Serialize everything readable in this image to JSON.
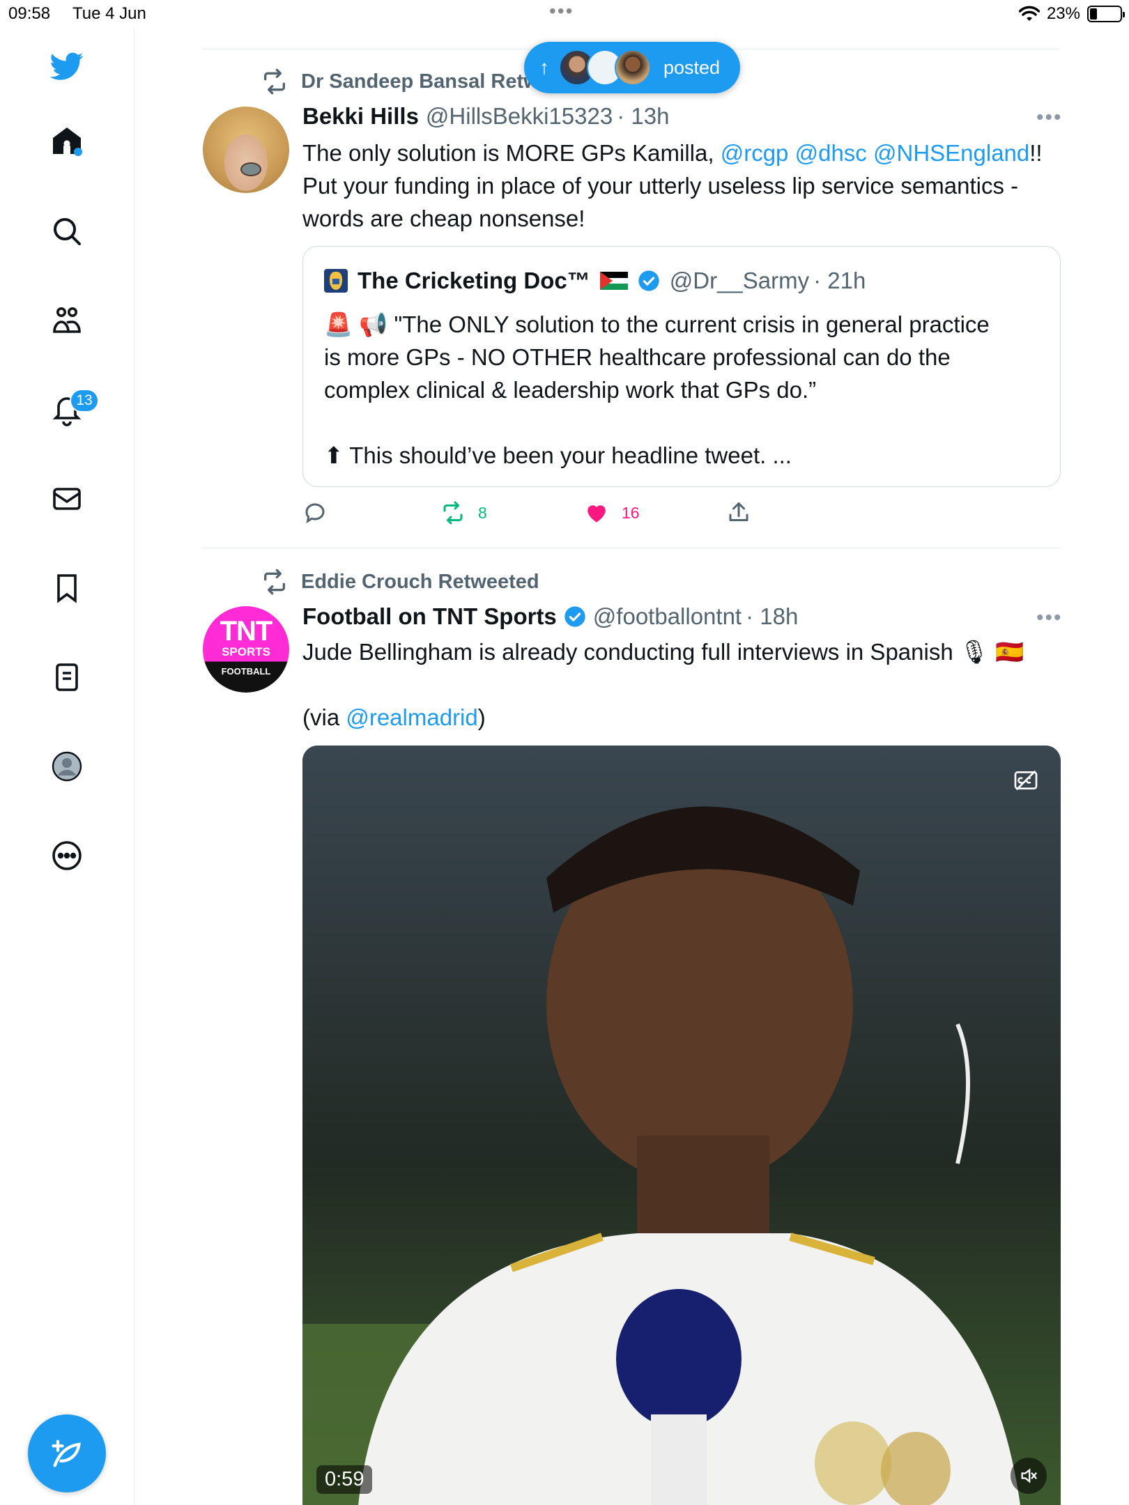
{
  "status_bar": {
    "time": "09:58",
    "date": "Tue 4 Jun",
    "dots": "•••",
    "battery": "23%",
    "battery_level": 0.23
  },
  "sidebar": {
    "items": [
      "home",
      "search",
      "communities",
      "notifications",
      "messages",
      "bookmarks",
      "lists",
      "profile",
      "more"
    ],
    "notifications_badge": "13"
  },
  "new_posts_pill": {
    "label": "posted",
    "arrow": "↑"
  },
  "tweets": [
    {
      "retweeted_by": "Dr Sandeep Bansal Retw",
      "name": "Bekki Hills",
      "handle": "@HillsBekki15323",
      "time": "· 13h",
      "more": "•••",
      "text_parts": {
        "p1": "The only solution is MORE GPs Kamilla, ",
        "m1": "@rcgp",
        "m2": "@dhsc",
        "m3": "@NHSEngland",
        "p2": "!!",
        "line2": "Put your funding in place of your utterly useless lip service semantics -",
        "line3": "words are cheap nonsense!"
      },
      "quote": {
        "name": "The Cricketing Doc™",
        "handle": "@Dr__Sarmy",
        "time": "· 21h",
        "line1": "\"The ONLY solution to the current crisis in general practice",
        "line2": "is more GPs - NO OTHER healthcare professional can do the",
        "line3": "complex clinical & leadership work that GPs do.”",
        "line4": "This should’ve been your headline tweet. ...",
        "emoji1": "🚨",
        "emoji2": "📢",
        "emoji3": "⬆"
      },
      "retweets": "8",
      "likes": "16",
      "colors": {
        "retweet": "#00ba7c",
        "like": "#f91880"
      }
    },
    {
      "retweeted_by": "Eddie Crouch Retweeted",
      "name": "Football on TNT Sports",
      "handle": "@footballontnt",
      "time": "· 18h",
      "more": "•••",
      "avatar_text": {
        "tnt": "TNT",
        "sports": "SPORTS",
        "football": "FOOTBALL"
      },
      "line1": "Jude Bellingham is already conducting full interviews in Spanish",
      "emoji_mic": "🎙",
      "emoji_flag": "🇪🇸",
      "via_prefix": "(via ",
      "via_mention": "@realmadrid",
      "via_suffix": ")",
      "video_time": "0:59"
    }
  ],
  "accent": "#1d9bf0"
}
